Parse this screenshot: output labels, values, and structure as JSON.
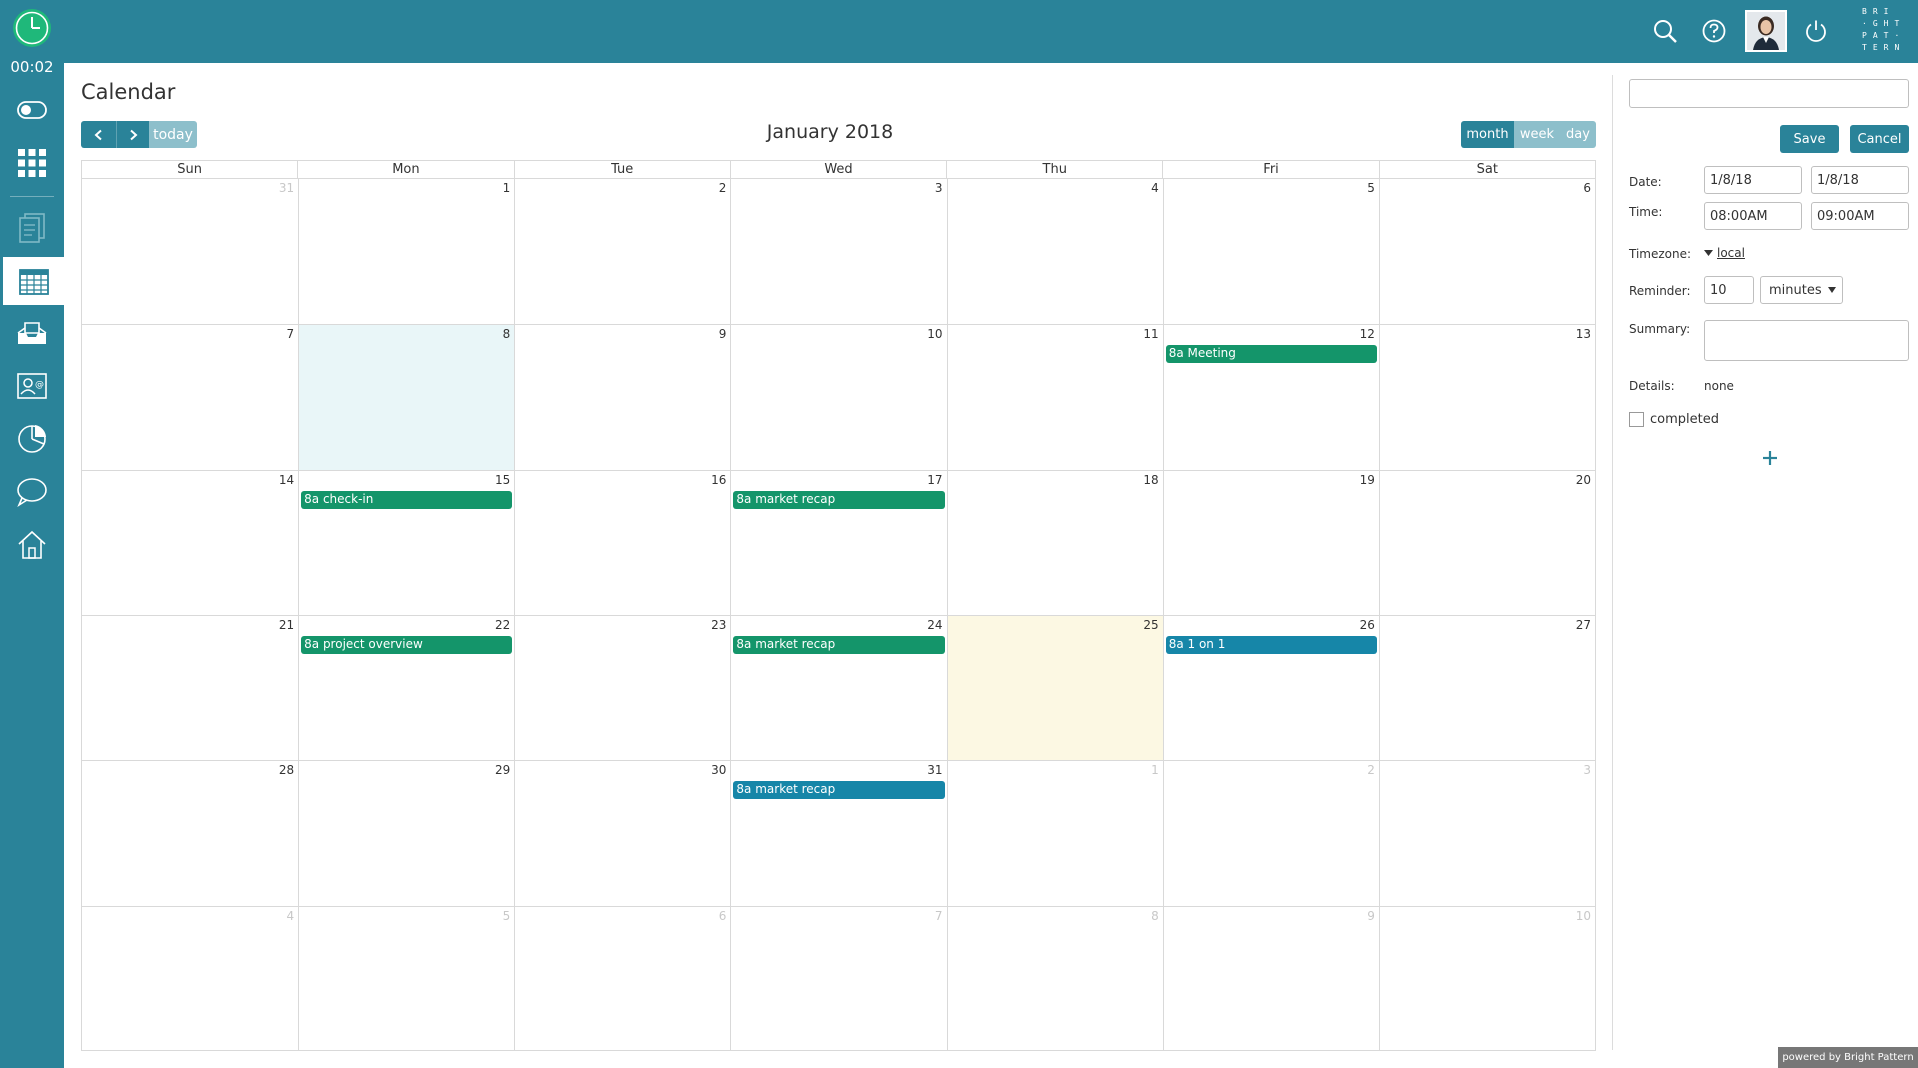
{
  "app": {
    "timer": "00:02",
    "logo_text": "BRI·GHT·PAT·TERN",
    "powered_by": "powered by Bright Pattern"
  },
  "colors": {
    "brand": "#2a8399",
    "event_green": "#14956a",
    "event_blue": "#1686a8",
    "selected_day": "#e9f6f8",
    "today": "#fcf8e3"
  },
  "page": {
    "title": "Calendar"
  },
  "toolbar": {
    "prev_icon": "chevron-left-icon",
    "next_icon": "chevron-right-icon",
    "today_label": "today",
    "month_label": "January 2018",
    "views": [
      "month",
      "week",
      "day"
    ],
    "active_view": "month"
  },
  "weekdays": [
    "Sun",
    "Mon",
    "Tue",
    "Wed",
    "Thu",
    "Fri",
    "Sat"
  ],
  "weeks": [
    [
      {
        "d": "31",
        "o": true
      },
      {
        "d": "1"
      },
      {
        "d": "2"
      },
      {
        "d": "3"
      },
      {
        "d": "4"
      },
      {
        "d": "5"
      },
      {
        "d": "6"
      }
    ],
    [
      {
        "d": "7"
      },
      {
        "d": "8",
        "sel": true
      },
      {
        "d": "9"
      },
      {
        "d": "10"
      },
      {
        "d": "11"
      },
      {
        "d": "12",
        "ev": "8a Meeting",
        "c": "green"
      },
      {
        "d": "13"
      }
    ],
    [
      {
        "d": "14"
      },
      {
        "d": "15",
        "ev": "8a check-in",
        "c": "green"
      },
      {
        "d": "16"
      },
      {
        "d": "17",
        "ev": "8a market recap",
        "c": "green"
      },
      {
        "d": "18"
      },
      {
        "d": "19"
      },
      {
        "d": "20"
      }
    ],
    [
      {
        "d": "21"
      },
      {
        "d": "22",
        "ev": "8a project overview",
        "c": "green"
      },
      {
        "d": "23"
      },
      {
        "d": "24",
        "ev": "8a market recap",
        "c": "green"
      },
      {
        "d": "25",
        "today": true
      },
      {
        "d": "26",
        "ev": "8a 1 on 1",
        "c": "blue"
      },
      {
        "d": "27"
      }
    ],
    [
      {
        "d": "28"
      },
      {
        "d": "29"
      },
      {
        "d": "30"
      },
      {
        "d": "31",
        "ev": "8a market recap",
        "c": "blue"
      },
      {
        "d": "1",
        "o": true
      },
      {
        "d": "2",
        "o": true
      },
      {
        "d": "3",
        "o": true
      }
    ],
    [
      {
        "d": "4",
        "o": true
      },
      {
        "d": "5",
        "o": true
      },
      {
        "d": "6",
        "o": true
      },
      {
        "d": "7",
        "o": true
      },
      {
        "d": "8",
        "o": true
      },
      {
        "d": "9",
        "o": true
      },
      {
        "d": "10",
        "o": true
      }
    ]
  ],
  "editor": {
    "title_value": "",
    "save_label": "Save",
    "cancel_label": "Cancel",
    "date_label": "Date:",
    "date_start": "1/8/18",
    "date_end": "1/8/18",
    "time_label": "Time:",
    "time_start": "08:00AM",
    "time_end": "09:00AM",
    "timezone_label": "Timezone:",
    "timezone_value": "local",
    "reminder_label": "Reminder:",
    "reminder_value": "10",
    "reminder_unit": "minutes",
    "summary_label": "Summary:",
    "summary_value": "",
    "details_label": "Details:",
    "details_value": "none",
    "completed_label": "completed",
    "completed": false,
    "add_icon": "plus-icon"
  }
}
